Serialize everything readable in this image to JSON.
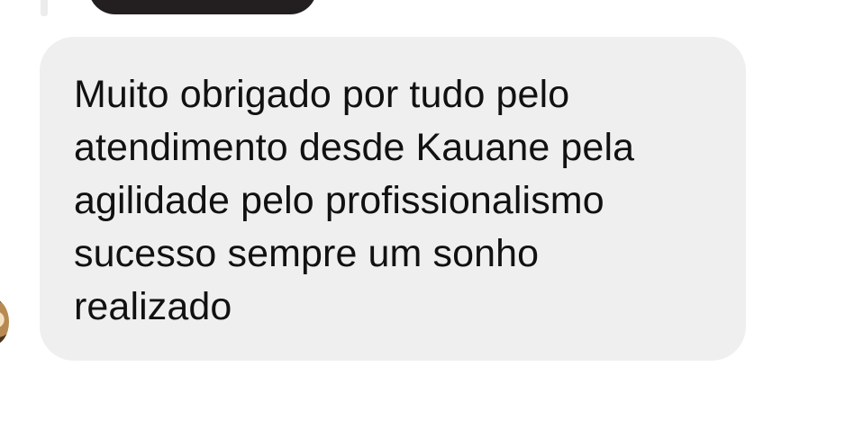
{
  "message": {
    "text": "Muito obrigado por tudo pelo\natendimento desde Kauane pela\nagilidade pelo profissionalismo\nsucesso sempre um sonho\nrealizado"
  },
  "colors": {
    "bubble_background": "#efefef",
    "message_text": "#111111",
    "previous_bubble": "#231f20"
  }
}
